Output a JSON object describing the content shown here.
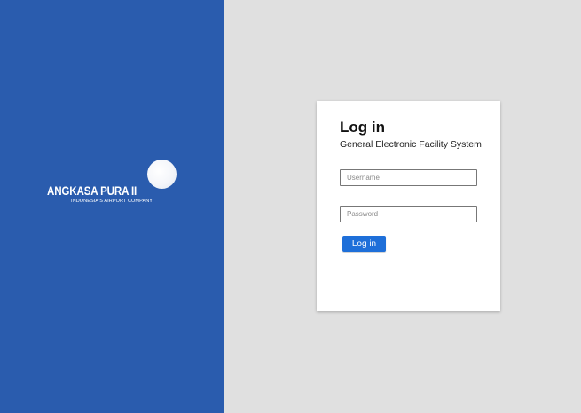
{
  "brand": {
    "name": "ANGKASA PURA II",
    "tagline": "INDONESIA'S AIRPORT COMPANY",
    "panel_color": "#2a5cae"
  },
  "login": {
    "title": "Log in",
    "subtitle": "General Electronic Facility System",
    "username_placeholder": "Username",
    "username_value": "",
    "password_placeholder": "Password",
    "password_value": "",
    "submit_label": "Log in",
    "button_color": "#1e6fd9"
  },
  "background_color": "#e0e0e0"
}
